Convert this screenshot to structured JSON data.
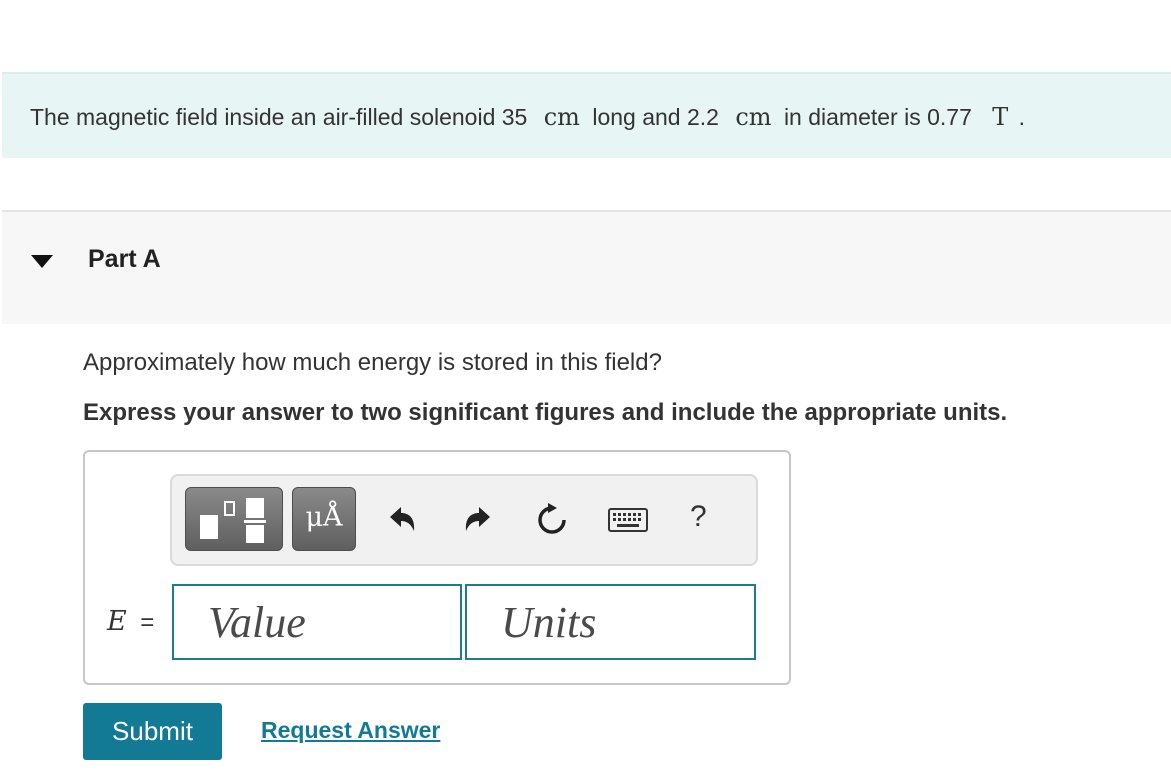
{
  "problem": {
    "text_1": "The magnetic field inside an air-filled solenoid 35",
    "unit_1": "cm",
    "text_2": "long and 2.2",
    "unit_2": "cm",
    "text_3": "in diameter is 0.77",
    "unit_3": "T",
    "text_4": "."
  },
  "part": {
    "title": "Part A",
    "question": "Approximately how much energy is stored in this field?",
    "instruction": "Express your answer to two significant figures and include the appropriate units."
  },
  "toolbar": {
    "templates_icon": "templates-icon",
    "units_label": "μÅ",
    "undo_icon": "undo-icon",
    "redo_icon": "redo-icon",
    "reset_icon": "reset-icon",
    "keyboard_icon": "keyboard-icon",
    "help_label": "?"
  },
  "answer": {
    "variable": "E",
    "equals": "=",
    "value_placeholder": "Value",
    "units_placeholder": "Units"
  },
  "actions": {
    "submit_label": "Submit",
    "request_answer_label": "Request Answer"
  },
  "colors": {
    "accent": "#137a96",
    "problem_bg": "#e8f5f5",
    "part_bg": "#f7f7f7"
  }
}
